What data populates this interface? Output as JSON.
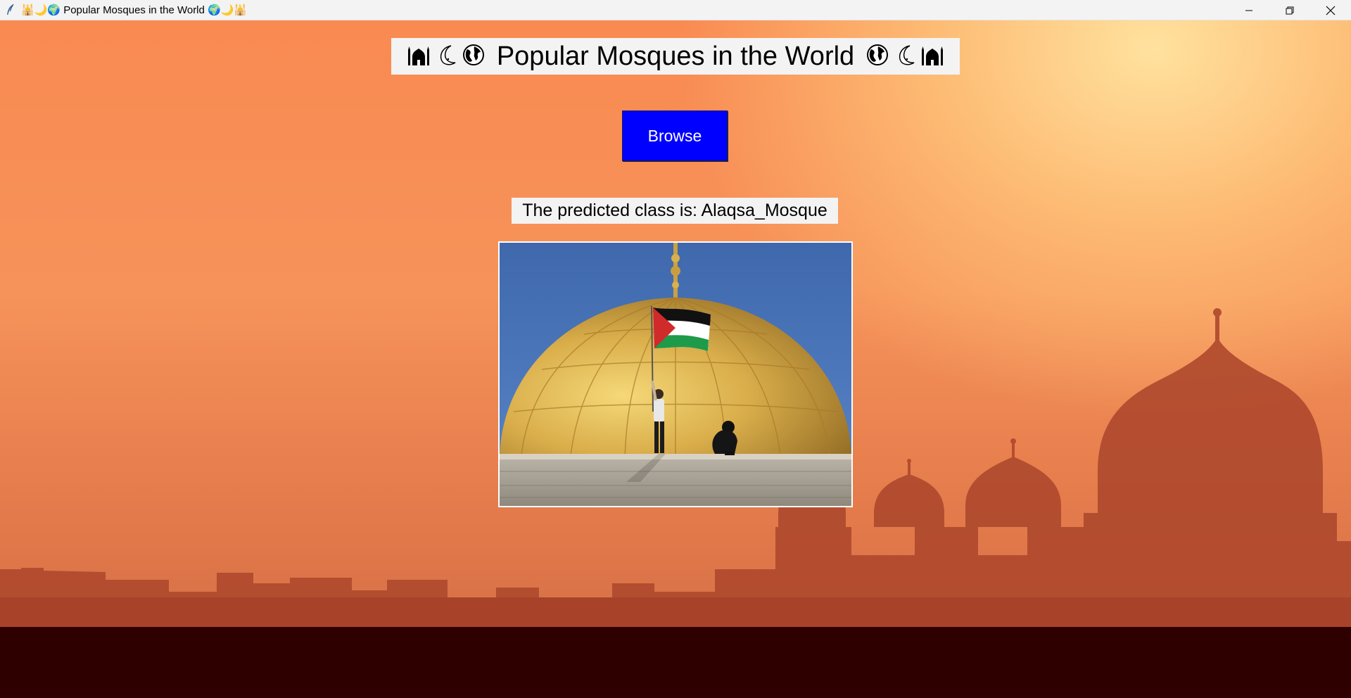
{
  "window": {
    "title": "🕌🌙🌍 Popular Mosques in the World 🌍🌙🕌",
    "controls": {
      "minimize_icon": "minimize-icon",
      "restore_icon": "restore-icon",
      "close_icon": "close-icon"
    }
  },
  "header": {
    "title": "Popular Mosques in the World",
    "left_emojis": [
      "mosque-icon",
      "crescent-moon-icon",
      "globe-icon"
    ],
    "right_emojis": [
      "globe-icon",
      "crescent-moon-icon",
      "mosque-icon"
    ]
  },
  "browse_button": {
    "label": "Browse",
    "color": "#0000ff"
  },
  "prediction": {
    "text": "The predicted class is: Alaqsa_Mosque"
  },
  "image": {
    "subject": "dome-of-the-rock-photo"
  },
  "colors": {
    "background_top": "#f98a52",
    "background_glow": "#ffe29e",
    "silhouette": "#a8432a",
    "ground": "#2e0000"
  }
}
